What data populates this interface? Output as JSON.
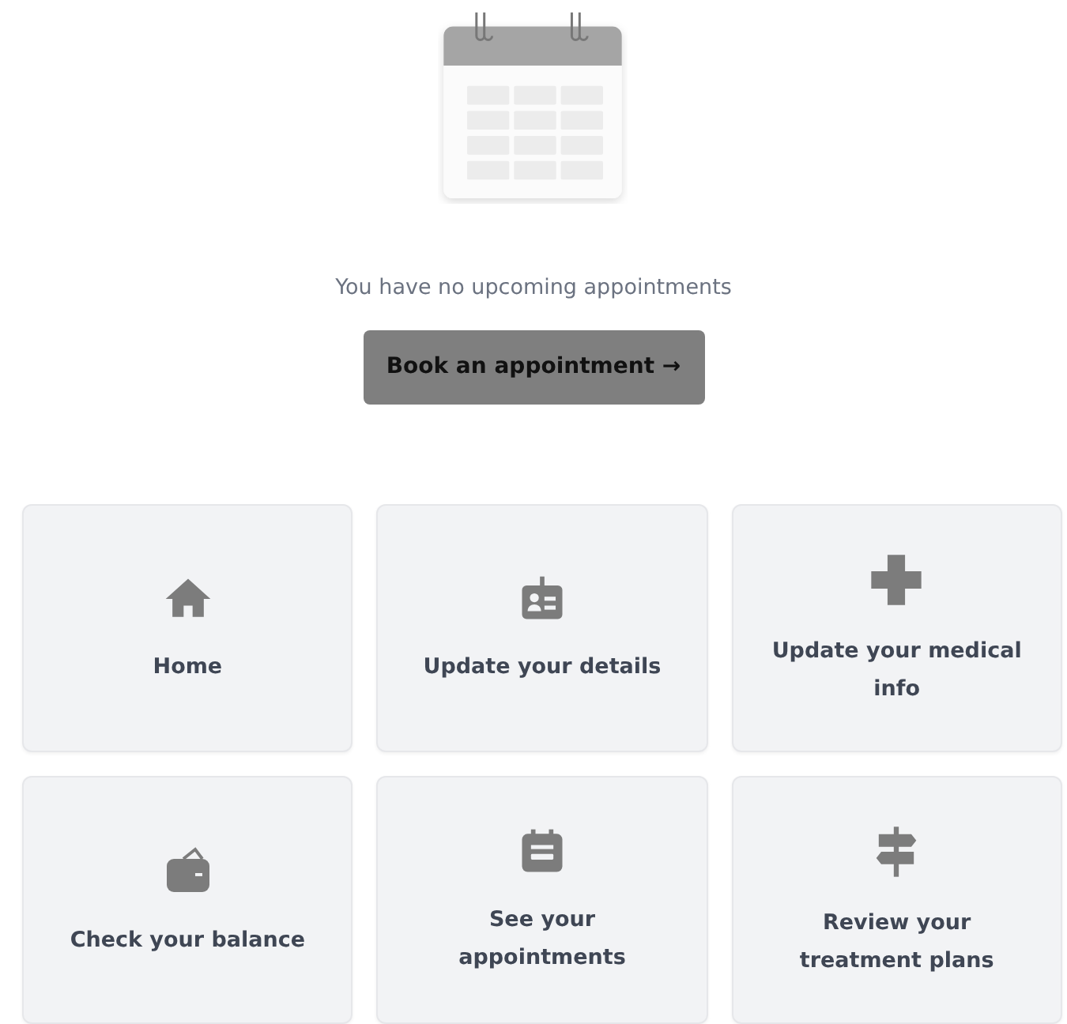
{
  "empty_state": {
    "message": "You have no upcoming appointments",
    "button": "Book an appointment →"
  },
  "tiles": [
    {
      "kind": "home",
      "label": "Home"
    },
    {
      "kind": "details",
      "label": "Update your details"
    },
    {
      "kind": "medical",
      "label": "Update your medical info"
    },
    {
      "kind": "balance",
      "label": "Check your balance"
    },
    {
      "kind": "appointments",
      "label": "See your appointments"
    },
    {
      "kind": "plans",
      "label": "Review your treatment plans"
    }
  ]
}
